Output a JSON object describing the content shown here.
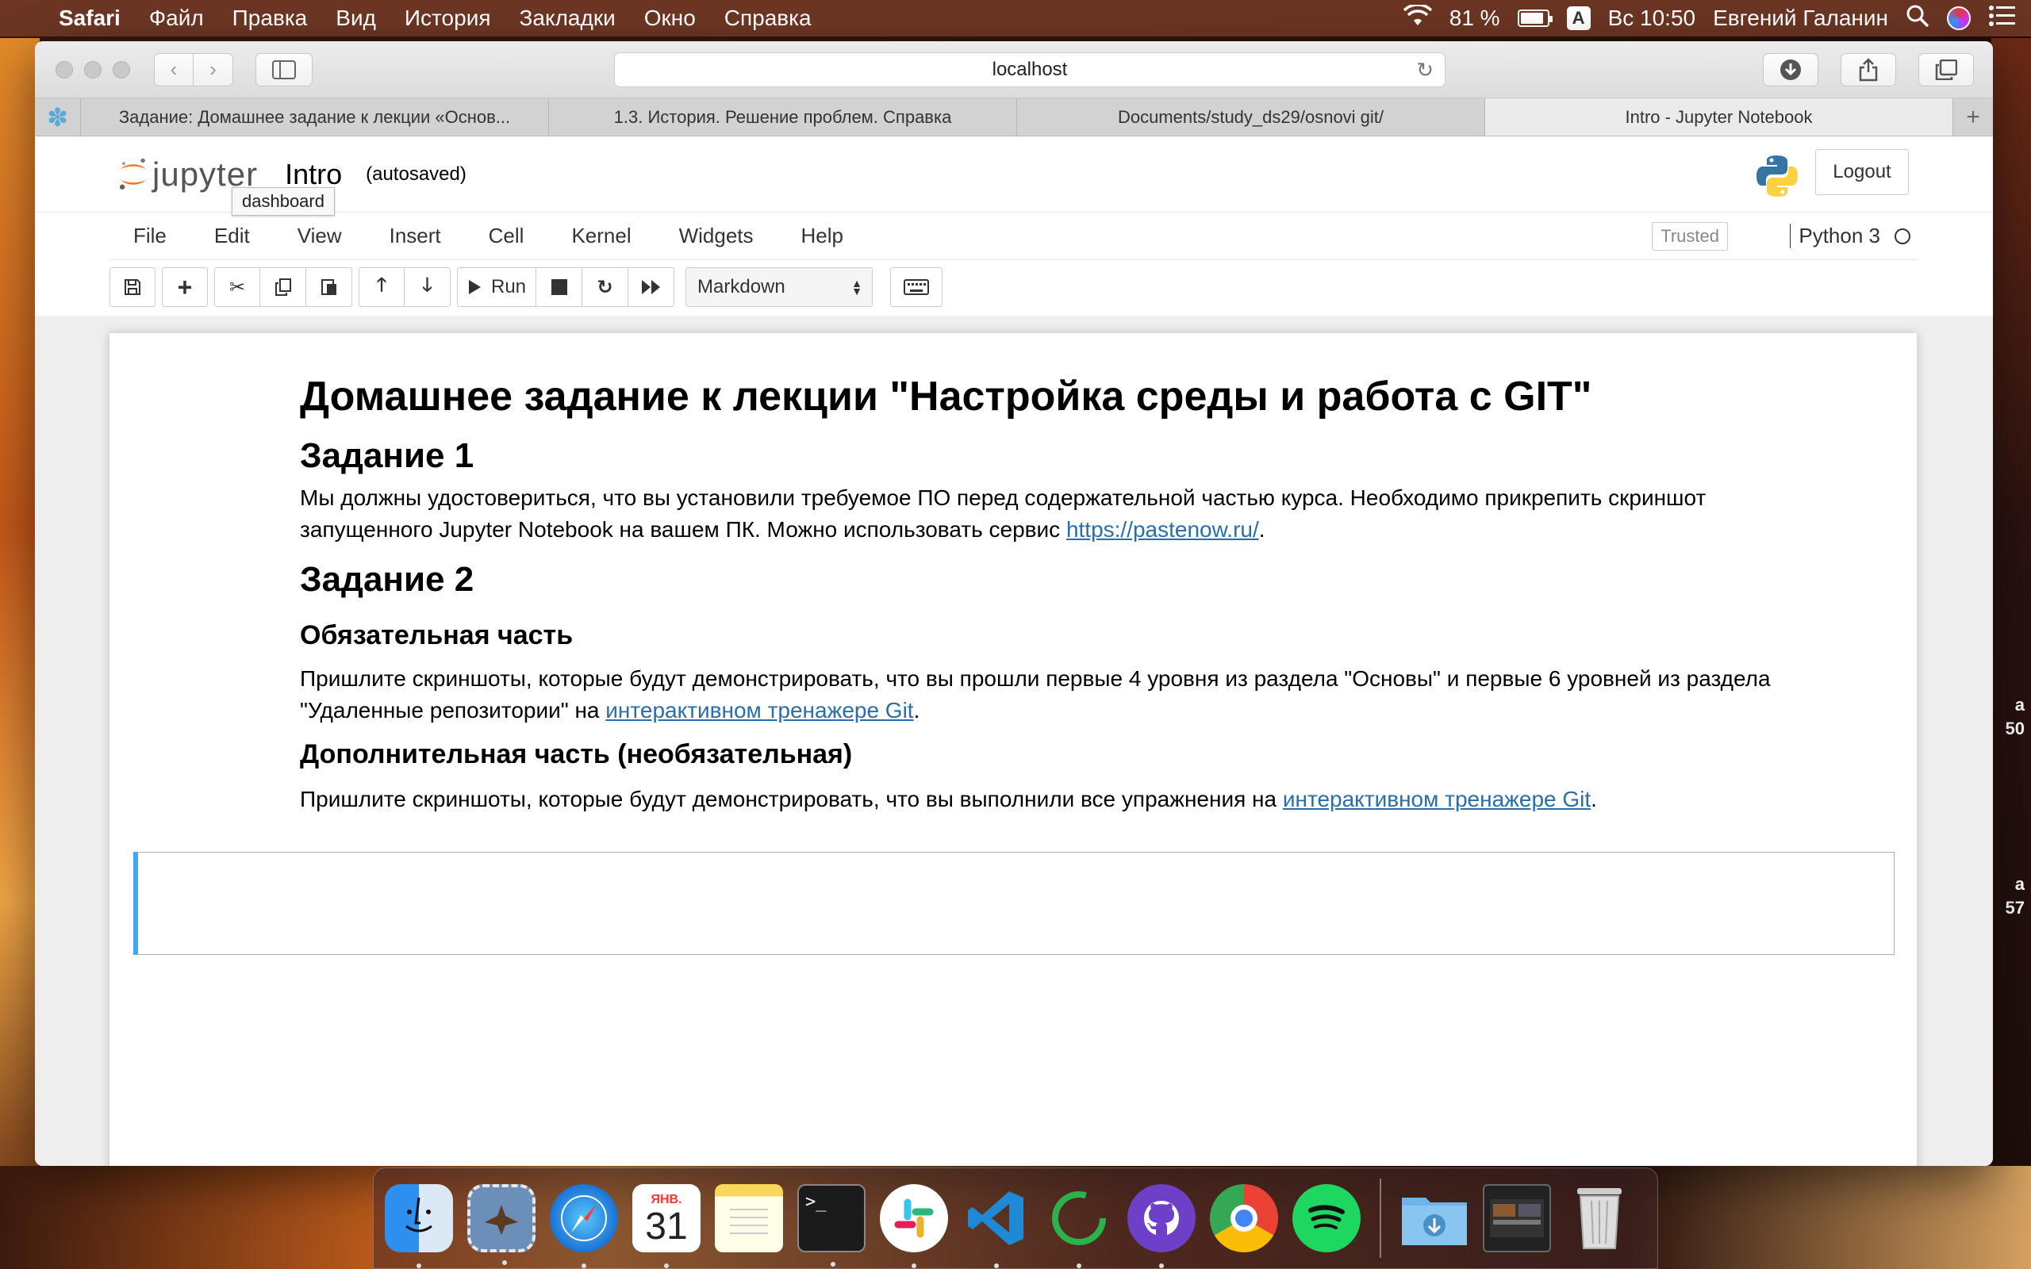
{
  "menubar": {
    "app": "Safari",
    "items": [
      "Файл",
      "Правка",
      "Вид",
      "История",
      "Закладки",
      "Окно",
      "Справка"
    ],
    "battery": "81 %",
    "keyboard": "A",
    "clock": "Вс 10:50",
    "user": "Евгений Галанин"
  },
  "safari": {
    "address": "localhost",
    "tabs": [
      "Задание: Домашнее задание к лекции «Основ...",
      "1.3. История. Решение проблем. Справка",
      "Documents/study_ds29/osnovi git/",
      "Intro - Jupyter Notebook"
    ],
    "active_tab": 3
  },
  "jupyter": {
    "logo_text": "jupyter",
    "notebook_name": "Intro",
    "autosave": "(autosaved)",
    "tooltip": "dashboard",
    "logout": "Logout",
    "menu": [
      "File",
      "Edit",
      "View",
      "Insert",
      "Cell",
      "Kernel",
      "Widgets",
      "Help"
    ],
    "trusted": "Trusted",
    "kernel": "Python 3",
    "toolbar": {
      "run_label": "Run",
      "cell_type": "Markdown"
    }
  },
  "notebook": {
    "h1": "Домашнее задание к лекции \"Настройка среды и работа с GIT\"",
    "task1_title": "Задание 1",
    "task1_text": "Мы должны удостовериться, что вы установили требуемое ПО перед содержательной частью курса. Необходимо прикрепить скриншот запущенного Jupyter Notebook на вашем ПК. Можно использовать сервис ",
    "task1_link": "https://pastenow.ru/",
    "task1_end": ".",
    "task2_title": "Задание 2",
    "required_title": "Обязательная часть",
    "required_text": "Пришлите скриншоты, которые будут демонстрировать, что вы прошли первые 4 уровня из раздела \"Основы\" и первые 6 уровней из раздела \"Удаленные репозитории\" на ",
    "required_link": "интерактивном тренажере Git",
    "required_end": ".",
    "optional_title": "Дополнительная часть (необязательная)",
    "optional_text": "Пришлите скриншоты, которые будут демонстрировать, что вы выполнили все упражнения на ",
    "optional_link": "интерактивном тренажере Git",
    "optional_end": "."
  },
  "desktop": {
    "side_text_1": "а\n50",
    "side_text_2": "а\n57"
  },
  "dock": {
    "calendar_month": "ЯНВ.",
    "calendar_day": "31"
  }
}
